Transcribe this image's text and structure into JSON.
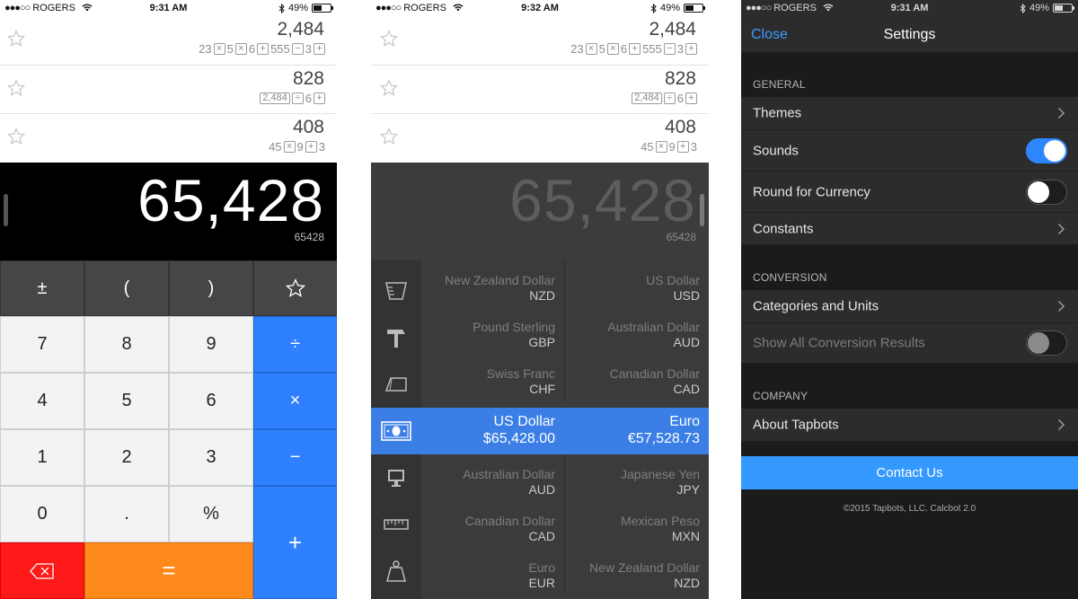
{
  "status_bars": [
    {
      "carrier": "ROGERS",
      "dots": "●●●○○",
      "time": "9:31 AM",
      "battery": "49%"
    },
    {
      "carrier": "ROGERS",
      "dots": "●●●○○",
      "time": "9:32 AM",
      "battery": "49%"
    },
    {
      "carrier": "ROGERS",
      "dots": "●●●○○",
      "time": "9:31 AM",
      "battery": "49%"
    }
  ],
  "history": [
    {
      "result": "2,484",
      "expr": [
        "23",
        "×",
        "5",
        "×",
        "6",
        "+",
        "555",
        "−",
        "3",
        "+"
      ]
    },
    {
      "result": "828",
      "expr": [
        "2,484",
        "÷",
        "6",
        "+"
      ]
    },
    {
      "result": "408",
      "expr": [
        "45",
        "×",
        "9",
        "+",
        "3"
      ]
    }
  ],
  "display": {
    "value": "65,428",
    "raw": "65428"
  },
  "keypad": {
    "plus_minus": "±",
    "open_paren": "(",
    "close_paren": ")",
    "k7": "7",
    "k8": "8",
    "k9": "9",
    "divide": "÷",
    "k4": "4",
    "k5": "5",
    "k6": "6",
    "multiply": "×",
    "k1": "1",
    "k2": "2",
    "k3": "3",
    "minus": "−",
    "k0": "0",
    "dot": ".",
    "percent": "%",
    "plus": "+",
    "equals": "="
  },
  "conversion": {
    "pairs": [
      {
        "left_name": "New Zealand Dollar",
        "left_code": "NZD",
        "right_name": "US Dollar",
        "right_code": "USD"
      },
      {
        "left_name": "Pound Sterling",
        "left_code": "GBP",
        "right_name": "Australian Dollar",
        "right_code": "AUD"
      },
      {
        "left_name": "Swiss Franc",
        "left_code": "CHF",
        "right_name": "Canadian Dollar",
        "right_code": "CAD"
      },
      {
        "left_name": "US Dollar",
        "left_code": "$65,428.00",
        "right_name": "Euro",
        "right_code": "€57,528.73"
      },
      {
        "left_name": "Australian Dollar",
        "left_code": "AUD",
        "right_name": "Japanese Yen",
        "right_code": "JPY"
      },
      {
        "left_name": "Canadian Dollar",
        "left_code": "CAD",
        "right_name": "Mexican Peso",
        "right_code": "MXN"
      },
      {
        "left_name": "Euro",
        "left_code": "EUR",
        "right_name": "New Zealand Dollar",
        "right_code": "NZD"
      }
    ],
    "categories": [
      "volume-icon",
      "hammer-icon",
      "area-icon",
      "currency-icon",
      "computer-icon",
      "length-icon",
      "weight-icon"
    ],
    "active_index": 3
  },
  "settings": {
    "close": "Close",
    "title": "Settings",
    "general_header": "GENERAL",
    "themes": "Themes",
    "sounds": "Sounds",
    "sounds_on": true,
    "round_currency": "Round for Currency",
    "round_currency_on": false,
    "constants": "Constants",
    "conversion_header": "CONVERSION",
    "categories_units": "Categories and Units",
    "show_all": "Show All Conversion Results",
    "show_all_on": false,
    "company_header": "COMPANY",
    "about": "About Tapbots",
    "contact": "Contact Us",
    "copyright": "©2015 Tapbots, LLC. Calcbot 2.0"
  },
  "colors": {
    "accent_blue": "#2f80ff",
    "delete_red": "#ff1a1a",
    "equals_orange": "#ff8a1c",
    "link_blue": "#3d9bff",
    "toggle_on": "#2e86ff"
  }
}
